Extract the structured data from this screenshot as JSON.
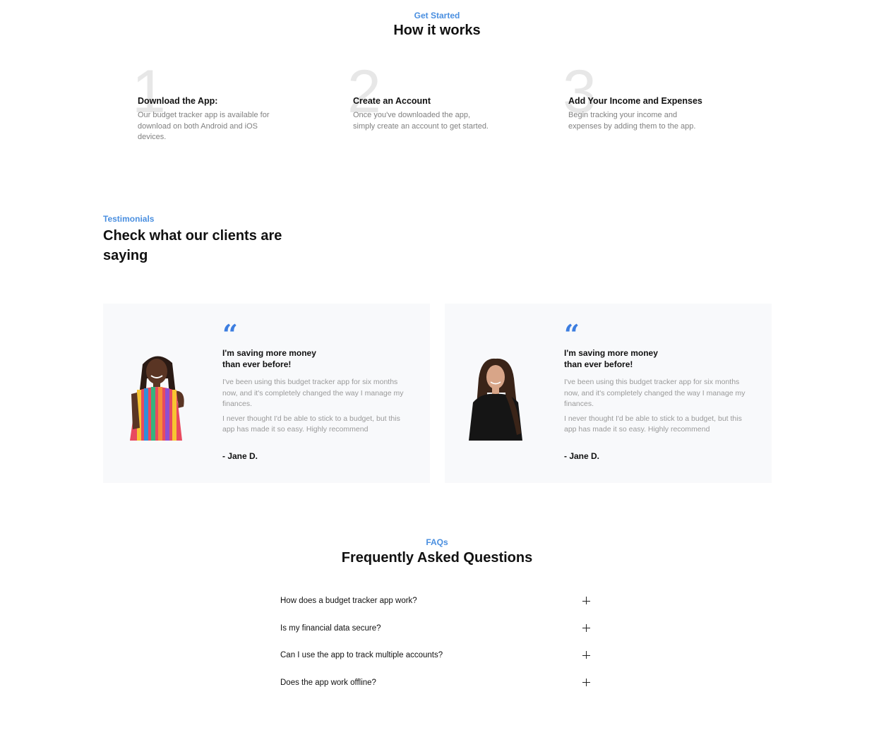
{
  "how_it_works": {
    "eyebrow": "Get Started",
    "title": "How it works",
    "steps": [
      {
        "number": "1",
        "title": "Download the App:",
        "description": "Our budget tracker app is available for download on both Android and iOS devices."
      },
      {
        "number": "2",
        "title": "Create an Account",
        "description": "Once you've downloaded the app, simply create an account to get started."
      },
      {
        "number": "3",
        "title": "Add Your Income and Expenses",
        "description": "Begin tracking your income and expenses by adding them to the app."
      }
    ]
  },
  "testimonials": {
    "eyebrow": "Testimonials",
    "title": "Check what our clients are saying",
    "quote_icon": "quote-icon",
    "cards": [
      {
        "heading": "I'm saving more money than ever before!",
        "paragraph_1": "I've been using this budget tracker app for six months now, and it's completely changed the way I manage my finances.",
        "paragraph_2": "I never thought I'd be able to stick to a budget, but this app has made it so easy. Highly recommend",
        "author": "- Jane D."
      },
      {
        "heading": "I'm saving more money than ever before!",
        "paragraph_1": "I've been using this budget tracker app for six months now, and it's completely changed the way I manage my finances.",
        "paragraph_2": "I never thought I'd be able to stick to a budget, but this app has made it so easy. Highly recommend",
        "author": "- Jane D."
      }
    ]
  },
  "faq": {
    "eyebrow": "FAQs",
    "title": "Frequently Asked Questions",
    "expand_icon": "plus-icon",
    "items": [
      {
        "question": "How does a budget tracker app work?"
      },
      {
        "question": "Is my financial data secure?"
      },
      {
        "question": "Can I use the app to track multiple accounts?"
      },
      {
        "question": "Does the app work offline?"
      }
    ]
  },
  "colors": {
    "accent": "#4a8fe0",
    "quote": "#3d7ee0",
    "card_background": "#f8f9fb",
    "step_number": "#e7e7e7"
  }
}
